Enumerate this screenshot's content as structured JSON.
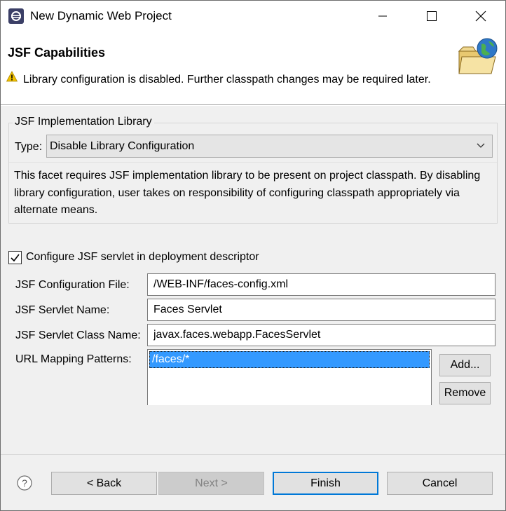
{
  "window": {
    "title": "New Dynamic Web Project"
  },
  "banner": {
    "title": "JSF Capabilities",
    "warning": "Library configuration is disabled. Further classpath changes may be required later."
  },
  "library_group": {
    "title": "JSF Implementation Library",
    "type_label": "Type:",
    "type_value": "Disable Library Configuration",
    "description": "This facet requires JSF implementation library to be present on project classpath. By disabling library configuration, user takes on responsibility of configuring classpath appropriately via alternate means."
  },
  "servlet": {
    "configure_label": "Configure JSF servlet in deployment descriptor",
    "configure_checked": true,
    "config_file_label": "JSF Configuration File:",
    "config_file_value": "/WEB-INF/faces-config.xml",
    "servlet_name_label": "JSF Servlet Name:",
    "servlet_name_value": "Faces Servlet",
    "servlet_class_label": "JSF Servlet Class Name:",
    "servlet_class_value": "javax.faces.webapp.FacesServlet",
    "url_patterns_label": "URL Mapping Patterns:",
    "url_patterns": [
      "/faces/*"
    ],
    "add_label": "Add...",
    "remove_label": "Remove"
  },
  "footer": {
    "back_label": "< Back",
    "next_label": "Next >",
    "finish_label": "Finish",
    "cancel_label": "Cancel"
  },
  "colors": {
    "accent": "#0078d7",
    "selection": "#3399ff",
    "warning": "#f0c000"
  }
}
